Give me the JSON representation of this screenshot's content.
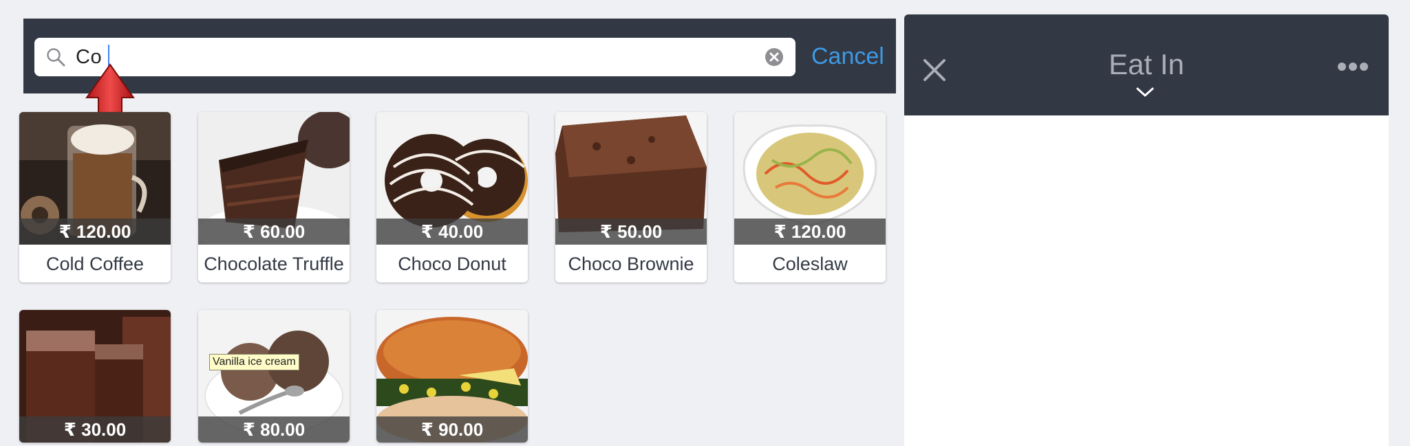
{
  "search": {
    "value": "Co",
    "cancel_label": "Cancel"
  },
  "products": [
    {
      "name": "Cold Coffee",
      "price": "₹ 120.00"
    },
    {
      "name": "Chocolate Truffle",
      "price": "₹ 60.00"
    },
    {
      "name": "Choco Donut",
      "price": "₹ 40.00"
    },
    {
      "name": "Choco Brownie",
      "price": "₹ 50.00"
    },
    {
      "name": "Coleslaw",
      "price": "₹ 120.00"
    },
    {
      "name": "",
      "price": "₹ 30.00"
    },
    {
      "name": "",
      "price": "₹ 80.00",
      "tooltip": "Vanilla ice cream"
    },
    {
      "name": "",
      "price": "₹ 90.00"
    }
  ],
  "order": {
    "title": "Eat In"
  },
  "colors": {
    "header_bg": "#323844",
    "accent": "#3d9ae4",
    "page_bg": "#eff0f4"
  },
  "icons": [
    "search-icon",
    "clear-icon",
    "close-icon",
    "chevron-down-icon",
    "more-icon",
    "up-arrow-annotation"
  ]
}
